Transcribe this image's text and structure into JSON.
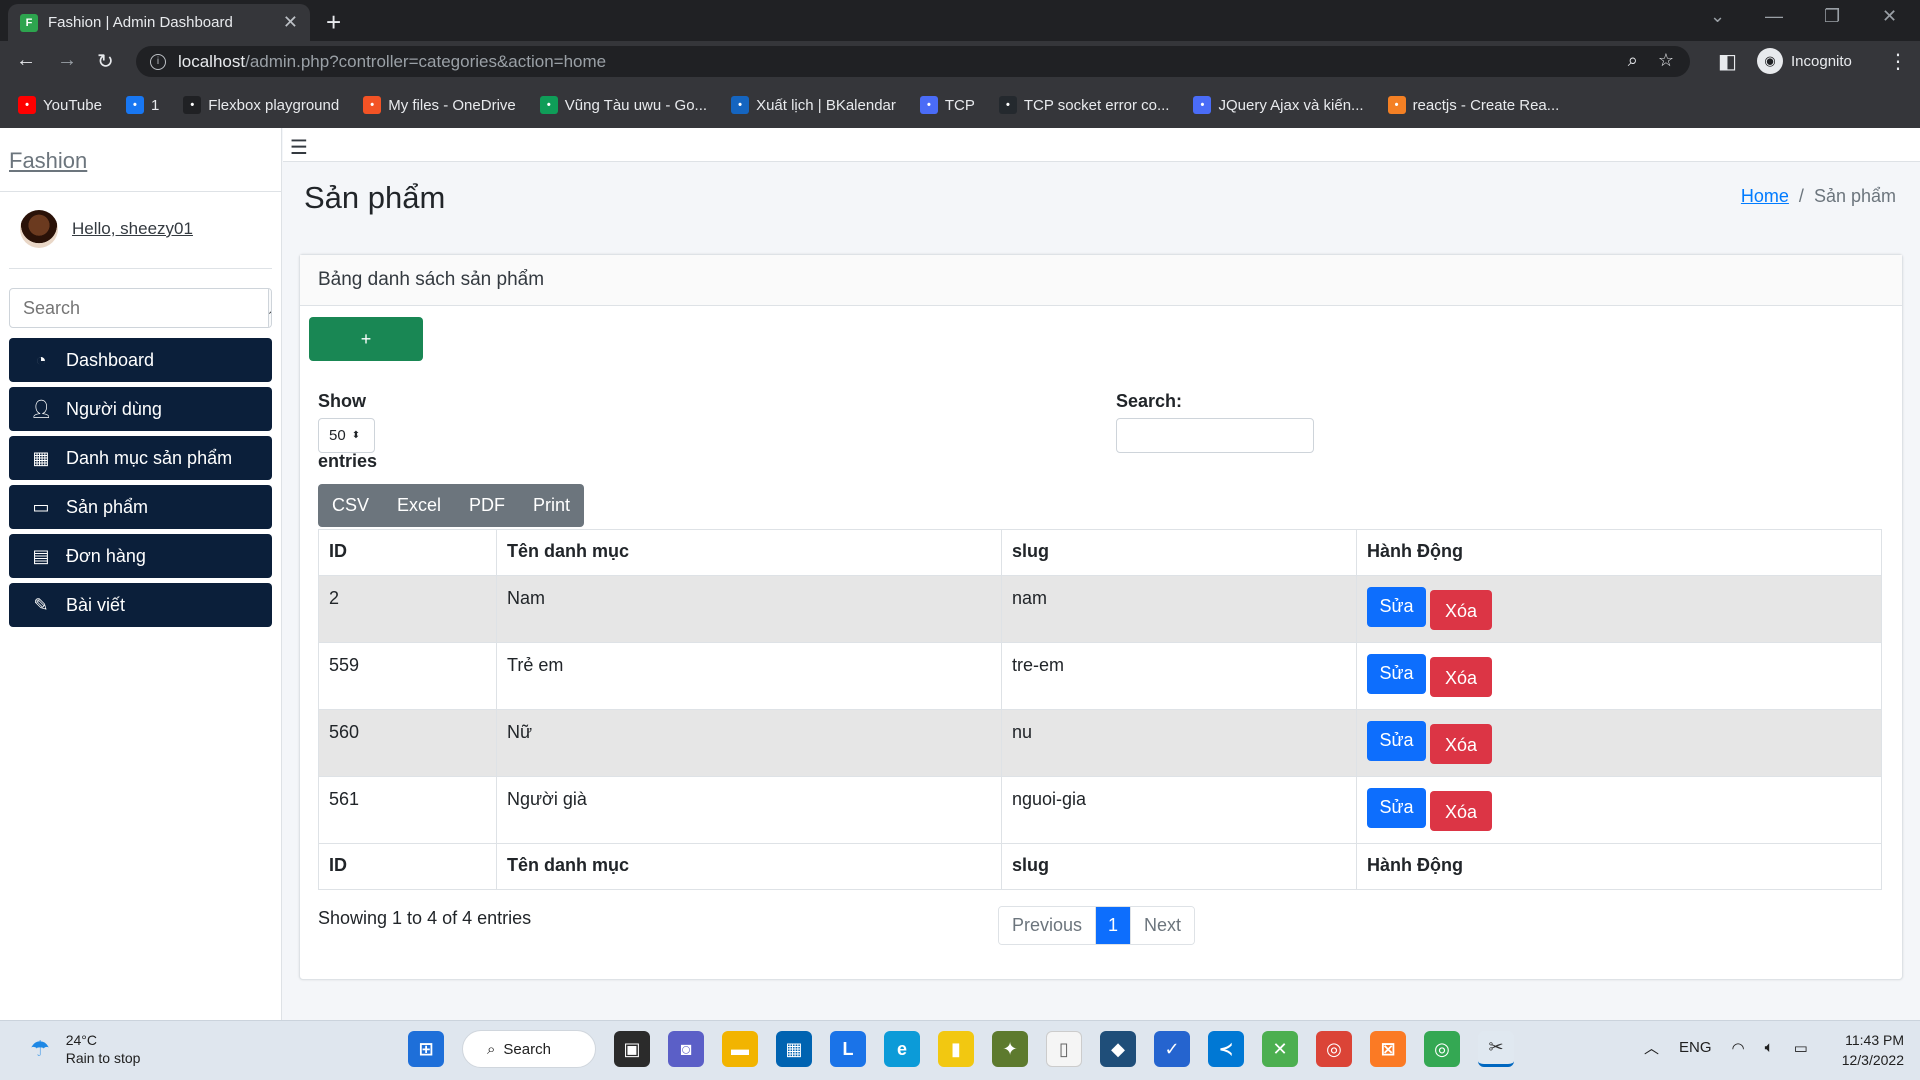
{
  "browser": {
    "tab_title": "Fashion | Admin Dashboard",
    "url_host": "localhost",
    "url_path": "/admin.php?controller=categories&action=home",
    "profile_label": "Incognito"
  },
  "bookmarks": [
    {
      "label": "YouTube",
      "icon": "youtube-icon",
      "color": "#ff0000"
    },
    {
      "label": "1",
      "icon": "facebook-icon",
      "color": "#1877f2"
    },
    {
      "label": "Flexbox playground",
      "icon": "flexbox-icon",
      "color": "#202124"
    },
    {
      "label": "My files - OneDrive",
      "icon": "microsoft-icon",
      "color": "#f35325"
    },
    {
      "label": "Vũng Tàu uwu - Go...",
      "icon": "sheets-icon",
      "color": "#0f9d58"
    },
    {
      "label": "Xuất lịch | BKalendar",
      "icon": "bkalendar-icon",
      "color": "#1565c0"
    },
    {
      "label": "TCP",
      "icon": "v-icon",
      "color": "#4a6cf7"
    },
    {
      "label": "TCP socket error co...",
      "icon": "github-icon",
      "color": "#24292e"
    },
    {
      "label": "JQuery Ajax và kiến...",
      "icon": "v-icon",
      "color": "#4a6cf7"
    },
    {
      "label": "reactjs - Create Rea...",
      "icon": "stackoverflow-icon",
      "color": "#f48024"
    }
  ],
  "sidebar": {
    "brand": "Fashion",
    "user": "Hello, sheezy01",
    "search_placeholder": "Search",
    "items": [
      {
        "label": "Dashboard",
        "icon": "dashboard-icon"
      },
      {
        "label": "Người dùng",
        "icon": "user-icon"
      },
      {
        "label": "Danh mục sản phẩm",
        "icon": "grid-icon"
      },
      {
        "label": "Sản phẩm",
        "icon": "monitor-icon"
      },
      {
        "label": "Đơn hàng",
        "icon": "invoice-icon"
      },
      {
        "label": "Bài viết",
        "icon": "blog-icon"
      }
    ]
  },
  "header": {
    "title": "Sản phẩm",
    "breadcrumb_home": "Home",
    "breadcrumb_sep": "/",
    "breadcrumb_current": "Sản phẩm"
  },
  "card": {
    "title": "Bảng danh sách sản phẩm",
    "add_label": "+",
    "show_label": "Show",
    "length_value": "50",
    "entries_label": "entries",
    "search_label": "Search:",
    "exports": [
      "CSV",
      "Excel",
      "PDF",
      "Print"
    ],
    "columns": [
      "ID",
      "Tên danh mục",
      "slug",
      "Hành Động"
    ],
    "rows": [
      {
        "id": "2",
        "name": "Nam",
        "slug": "nam"
      },
      {
        "id": "559",
        "name": "Trẻ em",
        "slug": "tre-em"
      },
      {
        "id": "560",
        "name": "Nữ",
        "slug": "nu"
      },
      {
        "id": "561",
        "name": "Người già",
        "slug": "nguoi-gia"
      }
    ],
    "edit_label": "Sửa",
    "delete_label": "Xóa",
    "info": "Showing 1 to 4 of 4 entries",
    "pager": {
      "prev": "Previous",
      "current": "1",
      "next": "Next"
    }
  },
  "taskbar": {
    "temp": "24°C",
    "weather": "Rain to stop",
    "search_label": "Search",
    "lang": "ENG",
    "time": "11:43 PM",
    "date": "12/3/2022"
  },
  "colors": {
    "sidebar_item_bg": "#0b1f3a",
    "add_button": "#198754",
    "edit_button": "#0d6efd",
    "delete_button": "#dc3545",
    "export_group": "#6c757d"
  }
}
